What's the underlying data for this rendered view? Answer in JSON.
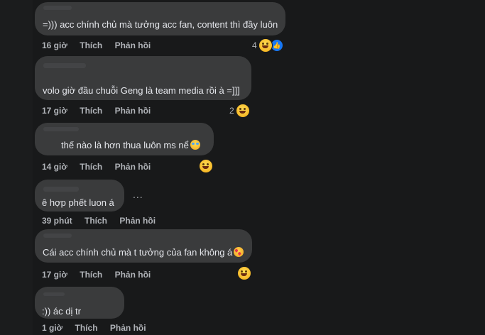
{
  "comments": [
    {
      "text": "=))) acc chính chủ mà tưởng acc fan, content thì đầy luôn",
      "time": "16 giờ",
      "like_label": "Thích",
      "reply_label": "Phản hồi",
      "reaction_count": "4",
      "reactions": [
        "laugh-emoji",
        "like-icon"
      ]
    },
    {
      "text": "volo giờ đầu chuỗi Geng là team media rồi à =]]]",
      "time": "17 giờ",
      "like_label": "Thích",
      "reply_label": "Phản hồi",
      "reaction_count": "2",
      "reactions": [
        "laugh-emoji"
      ]
    },
    {
      "text": "thế nào là hơn thua luôn ms nể",
      "time": "14 giờ",
      "like_label": "Thích",
      "reply_label": "Phản hồi",
      "reaction_count": "",
      "reactions": [
        "laugh-emoji"
      ]
    },
    {
      "text": "ê hợp phết luon á",
      "time": "39 phút",
      "like_label": "Thích",
      "reply_label": "Phản hồi",
      "more_label": "..."
    },
    {
      "text": "Cái acc chính chủ mà t tưởng của fan không á",
      "time": "17 giờ",
      "like_label": "Thích",
      "reply_label": "Phản hồi",
      "reaction_count": "",
      "reactions": [
        "laugh-emoji"
      ]
    },
    {
      "text": ":)) ác dị tr",
      "time": "1 giờ",
      "like_label": "Thích",
      "reply_label": "Phản hồi"
    }
  ],
  "colors": {
    "background": "#18191a",
    "bubble": "#3a3b3c",
    "text": "#e4e6eb",
    "meta": "#b0b3b8",
    "like": "#1877f2"
  }
}
